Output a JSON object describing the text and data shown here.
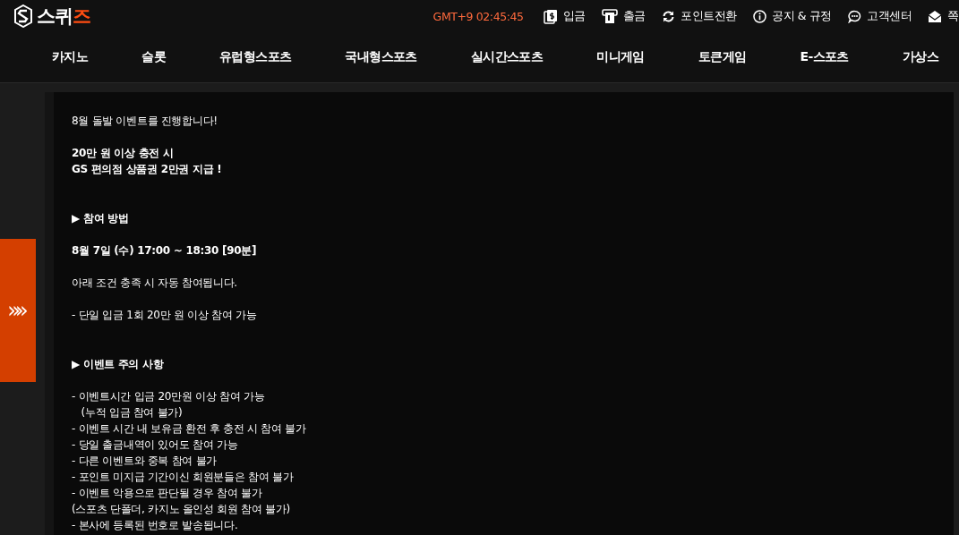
{
  "logo": {
    "text_main": "스퀴",
    "text_accent": "즈"
  },
  "clock": "GMT+9 02:45:45",
  "top_links": [
    {
      "kind": "deposit",
      "label": "입금"
    },
    {
      "kind": "withdraw",
      "label": "출금"
    },
    {
      "kind": "points",
      "label": "포인트전환"
    },
    {
      "kind": "notice",
      "label": "공지 & 규정"
    },
    {
      "kind": "support",
      "label": "고객센터"
    },
    {
      "kind": "message",
      "label": "쪽"
    }
  ],
  "nav": [
    "카지노",
    "슬롯",
    "유럽형스포츠",
    "국내형스포츠",
    "실시간스포츠",
    "미니게임",
    "토큰게임",
    "E-스포츠",
    "가상스"
  ],
  "side_tab": {
    "label": "»»"
  },
  "content": [
    {
      "kind": "text",
      "lines": [
        "8월 돌발 이벤트를 진행합니다!"
      ]
    },
    {
      "kind": "bold",
      "lines": [
        "20만 원 이상 충전 시",
        "GS 편의점 상품권 2만권 지급 !"
      ]
    },
    {
      "kind": "heading",
      "lines": [
        "▶ 참여 방법"
      ]
    },
    {
      "kind": "bold",
      "lines": [
        "8월 7일 (수) 17:00 ~ 18:30 [90분]"
      ]
    },
    {
      "kind": "text",
      "lines": [
        "아래 조건 충족 시 자동 참여됩니다."
      ]
    },
    {
      "kind": "text",
      "lines": [
        "- 단일 입금 1회 20만 원 이상 참여 가능"
      ]
    },
    {
      "kind": "heading",
      "lines": [
        "▶ 이벤트 주의 사항"
      ]
    },
    {
      "kind": "text",
      "lines": [
        "- 이벤트시간 입금 20만원 이상 참여 가능",
        "   (누적 입금 참여 불가)",
        "- 이벤트 시간 내 보유금 환전 후 충전 시 참여 불가",
        "- 당일 출금내역이 있어도 참여 가능",
        "- 다른 이벤트와 중복 참여 불가",
        "- 포인트 미지급 기간이신 회원분들은 참여 불가",
        "- 이벤트 악용으로 판단될 경우 참여 불가",
        "(스포츠 단폴더, 카지노 올인성 회원 참여 불가)",
        "- 본사에 등록된 번호로 발송됩니다."
      ]
    }
  ]
}
